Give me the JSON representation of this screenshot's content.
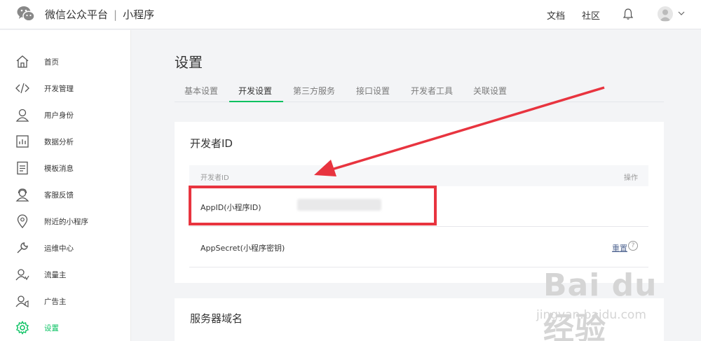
{
  "header": {
    "brand": "微信公众平台",
    "separator": "|",
    "product": "小程序",
    "nav": [
      "文档",
      "社区"
    ]
  },
  "sidebar": {
    "items": [
      {
        "label": "首页",
        "icon": "home-icon"
      },
      {
        "label": "开发管理",
        "icon": "code-icon"
      },
      {
        "label": "用户身份",
        "icon": "user-icon"
      },
      {
        "label": "数据分析",
        "icon": "chart-icon"
      },
      {
        "label": "模板消息",
        "icon": "document-icon"
      },
      {
        "label": "客服反馈",
        "icon": "customer-service-icon"
      },
      {
        "label": "附近的小程序",
        "icon": "location-icon"
      },
      {
        "label": "运维中心",
        "icon": "wrench-icon"
      },
      {
        "label": "流量主",
        "icon": "traffic-user-icon"
      },
      {
        "label": "广告主",
        "icon": "advertiser-icon"
      },
      {
        "label": "设置",
        "icon": "gear-icon",
        "active": true
      }
    ]
  },
  "main": {
    "title": "设置",
    "tabs": [
      {
        "label": "基本设置"
      },
      {
        "label": "开发设置",
        "active": true
      },
      {
        "label": "第三方服务"
      },
      {
        "label": "接口设置"
      },
      {
        "label": "开发者工具"
      },
      {
        "label": "关联设置"
      }
    ],
    "developer_card": {
      "title": "开发者ID",
      "columns": [
        "开发者ID",
        "操作"
      ],
      "rows": [
        {
          "label": "AppID(小程序ID)",
          "value_hidden": true
        },
        {
          "label": "AppSecret(小程序密钥)",
          "action": "重置",
          "help": "?"
        }
      ]
    },
    "server_card": {
      "title": "服务器域名"
    }
  },
  "watermark": {
    "brand": "Bai du 经验",
    "url": "jingyan.baidu.com"
  },
  "colors": {
    "accent": "#07c160",
    "link": "#576b95",
    "annotation": "#e8343f"
  }
}
